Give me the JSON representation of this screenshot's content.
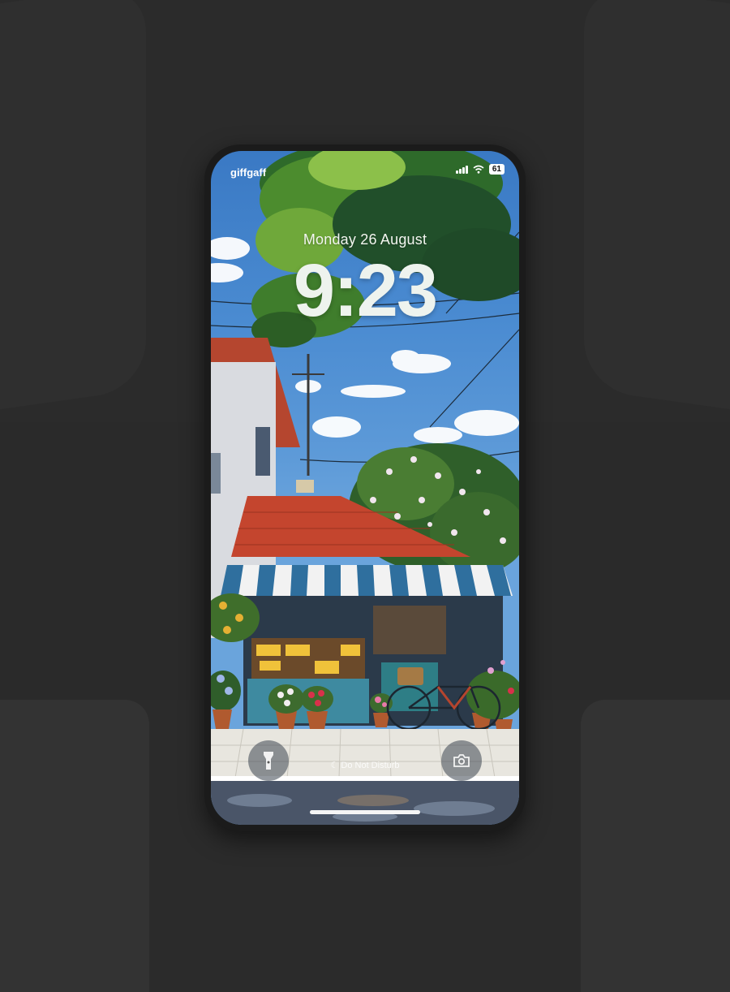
{
  "status_bar": {
    "carrier": "giffgaff",
    "battery": "61",
    "signal_icon": "signal-bars-icon",
    "wifi_icon": "wifi-icon"
  },
  "lock_screen": {
    "date": "Monday 26 August",
    "time": "9:23",
    "focus_label": "Do Not Disturb",
    "flashlight_icon": "flashlight-icon",
    "camera_icon": "camera-icon"
  },
  "colors": {
    "background": "#2b2b2b",
    "phone_frame": "#1b1b1b",
    "sky": "#3a79c4",
    "awning_blue": "#2f6f9e",
    "roof_red": "#c4452e"
  }
}
